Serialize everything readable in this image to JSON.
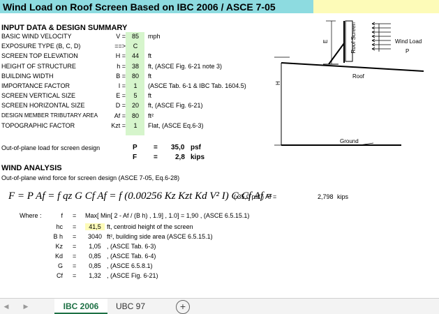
{
  "title": "Wind Load on Roof Screen Based on IBC 2006 / ASCE 7-05",
  "input_section": "INPUT DATA & DESIGN SUMMARY",
  "inputs": [
    {
      "label": "BASIC WIND VELOCITY",
      "sym": "V =",
      "val": "85",
      "unit": "mph"
    },
    {
      "label": "EXPOSURE TYPE (B, C, D)",
      "sym": "==>",
      "val": "C",
      "unit": ""
    },
    {
      "label": "SCREEN TOP ELEVATION",
      "sym": "H =",
      "val": "44",
      "unit": "ft"
    },
    {
      "label": "HEIGHT OF STRUCTURE",
      "sym": "h =",
      "val": "38",
      "unit": "ft, (ASCE Fig. 6-21 note 3)"
    },
    {
      "label": "BUILDING WIDTH",
      "sym": "B =",
      "val": "80",
      "unit": "ft"
    },
    {
      "label": "IMPORTANCE FACTOR",
      "sym": "I =",
      "val": "1",
      "unit": "(ASCE Tab. 6-1 & IBC Tab. 1604.5)"
    },
    {
      "label": "SCREEN VERTICAL SIZE",
      "sym": "E =",
      "val": "5",
      "unit": "ft"
    },
    {
      "label": "SCREEN HORIZONTAL SIZE",
      "sym": "D =",
      "val": "20",
      "unit": "ft, (ASCE Fig. 6-21)"
    },
    {
      "label": "DESIGN MEMBER TRIBUTARY AREA",
      "sym": "Af =",
      "val": "80",
      "unit": "ft²"
    },
    {
      "label": "TOPOGRAPHIC FACTOR",
      "sym": "Kzt =",
      "val": "1",
      "unit": "Flat, (ASCE Eq.6-3)"
    }
  ],
  "outofplane": {
    "label": "Out-of-plane load for screen design",
    "p_sym": "P",
    "p_eq": "=",
    "p_val": "35,0",
    "p_unit": "psf",
    "f_sym": "F",
    "f_eq": "=",
    "f_val": "2,8",
    "f_unit": "kips"
  },
  "wind_section": "WIND ANALYSIS",
  "wind_sub": "Out-of-plane wind force for screen design (ASCE 7-05, Eq.6-28)",
  "formula": {
    "lhs": "F = P Af = f qz G Cf Af = f (0.00256 Kz Kzt Kd V² I) G Cf Af =",
    "mid": "(   35,0   psf ) Af =",
    "res": "2,798",
    "unit": "kips"
  },
  "where": {
    "label": "Where :",
    "rows": [
      {
        "sym": "f",
        "eq": "=",
        "val": "Max[ Min[ 2 - Af / (B h) , 1.9] , 1.0] =   1,90   , (ASCE 6.5.15.1)"
      },
      {
        "sym": "hc",
        "eq": "=",
        "val": "41,5",
        "desc": "ft, centroid height of the screen"
      },
      {
        "sym": "B h",
        "eq": "=",
        "val": "3040",
        "desc": "ft², building side area (ASCE 6.5.15.1)"
      },
      {
        "sym": "Kz",
        "eq": "=",
        "val": "1,05",
        "desc": ", (ASCE Tab. 6-3)"
      },
      {
        "sym": "Kd",
        "eq": "=",
        "val": "0,85",
        "desc": ", (ASCE Tab. 6-4)"
      },
      {
        "sym": "G",
        "eq": "=",
        "val": "0,85",
        "desc": ", (ASCE 6.5.8.1)"
      },
      {
        "sym": "Cf",
        "eq": "=",
        "val": "1,32",
        "desc": ", (ASCE Fig. 6-21)"
      }
    ]
  },
  "diagram": {
    "screen": "Roof Screen",
    "wind": "Wind Load",
    "p": "P",
    "roof": "Roof",
    "ground": "Ground",
    "h": "H",
    "e": "E"
  },
  "tabs": [
    "IBC 2006",
    "UBC 97"
  ],
  "nav_left": "◀",
  "nav_right": "▶",
  "add": "+"
}
